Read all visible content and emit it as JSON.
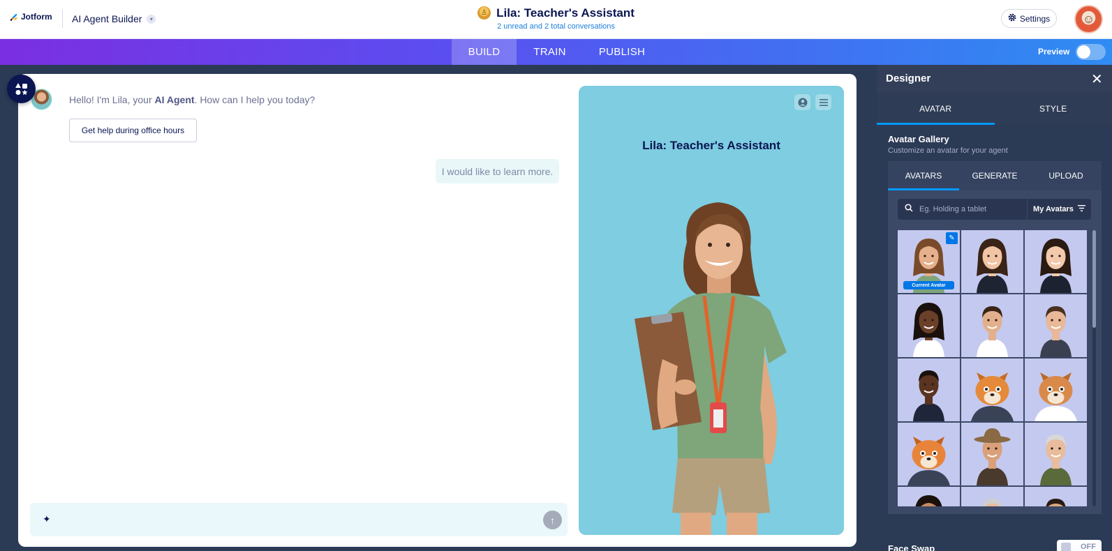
{
  "header": {
    "logo_text": "Jotform",
    "product": "AI Agent Builder",
    "agent_title": "Lila: Teacher's Assistant",
    "subtitle": "2 unread and 2 total conversations",
    "settings_label": "Settings"
  },
  "nav": {
    "tabs": [
      {
        "label": "BUILD",
        "active": true
      },
      {
        "label": "TRAIN",
        "active": false
      },
      {
        "label": "PUBLISH",
        "active": false
      }
    ],
    "preview_label": "Preview",
    "preview_on": false
  },
  "chat": {
    "greeting_prefix": "Hello! I'm Lila, your ",
    "greeting_bold": "AI Agent",
    "greeting_suffix": ". How can I help you today?",
    "quick_reply": "Get help during office hours",
    "user_message": "I would like to learn more."
  },
  "preview": {
    "title": "Lila: Teacher's Assistant"
  },
  "designer": {
    "title": "Designer",
    "tabs": [
      {
        "label": "AVATAR",
        "active": true
      },
      {
        "label": "STYLE",
        "active": false
      }
    ],
    "gallery_title": "Avatar Gallery",
    "gallery_desc": "Customize an avatar for your agent",
    "sub_tabs": [
      {
        "label": "AVATARS",
        "active": true
      },
      {
        "label": "GENERATE",
        "active": false
      },
      {
        "label": "UPLOAD",
        "active": false
      }
    ],
    "search_placeholder": "Eg. Holding a tablet",
    "filter_label": "My Avatars",
    "current_avatar_label": "Current Avatar",
    "face_swap_label": "Face Swap",
    "face_swap_state": "OFF"
  },
  "avatar_tiles": [
    {
      "kind": "woman",
      "skin": "#e6b08c",
      "hair": "#7a4b2a",
      "shirt": "#7fa57a",
      "current": true
    },
    {
      "kind": "woman",
      "skin": "#f0c4a4",
      "hair": "#3a2418",
      "shirt": "#1f2433",
      "current": false
    },
    {
      "kind": "woman",
      "skin": "#f2c9ab",
      "hair": "#2a1a12",
      "shirt": "#1d2230",
      "current": false
    },
    {
      "kind": "woman",
      "skin": "#6b4029",
      "hair": "#1a110c",
      "shirt": "#ffffff",
      "current": false
    },
    {
      "kind": "man",
      "skin": "#e2b08d",
      "hair": "#3b2517",
      "shirt": "#ffffff",
      "current": false
    },
    {
      "kind": "man",
      "skin": "#e8b898",
      "hair": "#4a3020",
      "shirt": "#3a4050",
      "current": false
    },
    {
      "kind": "man",
      "skin": "#5a3420",
      "hair": "#1a110c",
      "shirt": "#20263a",
      "current": false
    },
    {
      "kind": "fox",
      "skin": "#e58a3a",
      "hair": "#c96b22",
      "shirt": "#3a4257",
      "current": false
    },
    {
      "kind": "fox",
      "skin": "#d98a4a",
      "hair": "#b86a2a",
      "shirt": "#ffffff",
      "current": false
    },
    {
      "kind": "fox",
      "skin": "#e8843a",
      "hair": "#c4621c",
      "shirt": "#3a4257",
      "current": false
    },
    {
      "kind": "hat",
      "skin": "#d9a07a",
      "hair": "#8a6a44",
      "shirt": "#4a3a2e",
      "current": false
    },
    {
      "kind": "man",
      "skin": "#e8bc9c",
      "hair": "#d8d8d8",
      "shirt": "#5a6a3a",
      "current": false
    },
    {
      "kind": "woman",
      "skin": "#c68a62",
      "hair": "#1a110c",
      "shirt": "#2a2a2a",
      "current": false
    },
    {
      "kind": "man",
      "skin": "#e8bc9c",
      "hair": "#cfcfcf",
      "shirt": "#ffffff",
      "current": false
    },
    {
      "kind": "man",
      "skin": "#d8a880",
      "hair": "#2a1a12",
      "shirt": "#2a2a2a",
      "current": false
    }
  ],
  "colors": {
    "brand_navy": "#0a1551",
    "accent_blue": "#0099ff",
    "preview_bg": "#7ecde0",
    "panel_bg": "#2b3a55"
  }
}
